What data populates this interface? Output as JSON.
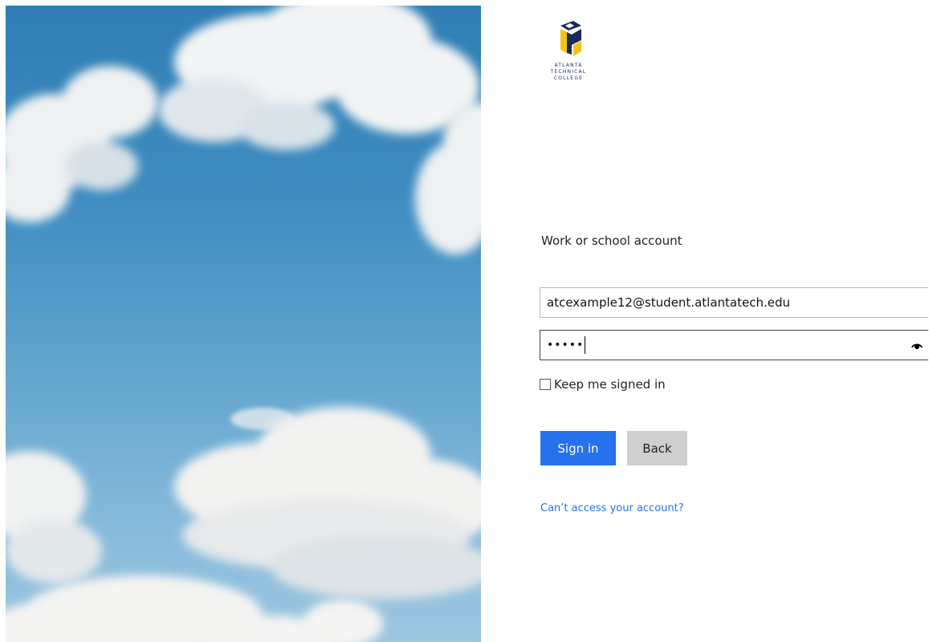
{
  "logo": {
    "text_lines": [
      "ATLANTA",
      "TECHNICAL",
      "COLLEGE"
    ]
  },
  "form": {
    "title": "Work or school account",
    "email": {
      "value": "atcexample12@student.atlantatech.edu"
    },
    "password": {
      "masked_value": "•••••",
      "reveal_icon": "eye-icon"
    },
    "keep_signed_in": {
      "label": "Keep me signed in",
      "checked": false
    },
    "buttons": {
      "sign_in": "Sign in",
      "back": "Back"
    },
    "help_link": "Can’t access your account?"
  },
  "colors": {
    "primary": "#2672ec",
    "secondary_button": "#cfcfcf",
    "logo_navy": "#1b2a5c",
    "logo_gold": "#f2c417"
  },
  "illustration": "sky-with-clouds"
}
